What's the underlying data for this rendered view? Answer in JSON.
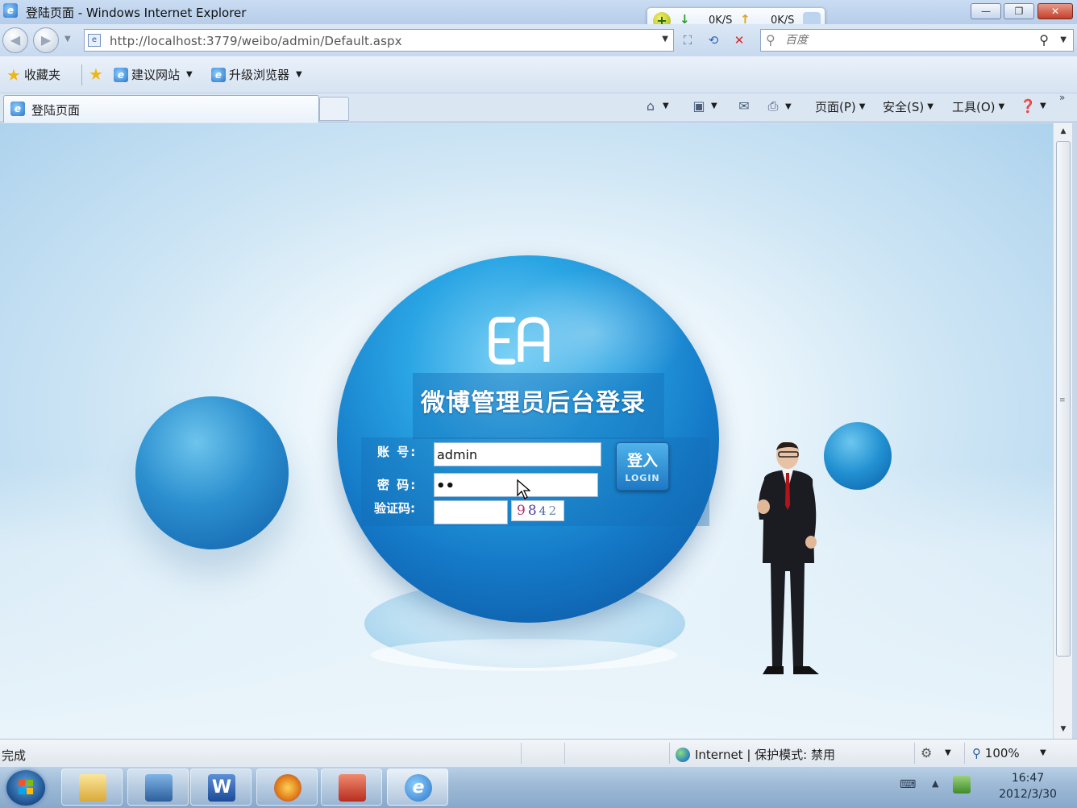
{
  "window": {
    "title": "登陆页面 - Windows Internet Explorer",
    "minimize": "—",
    "restore": "❐",
    "close": "✕"
  },
  "speed_widget": {
    "download": "0K/S",
    "upload": "0K/S"
  },
  "navigation": {
    "url": "http://localhost:3779/weibo/admin/Default.aspx",
    "search_placeholder": "百度"
  },
  "favorites_bar": {
    "favorites": "收藏夹",
    "suggested_sites": "建议网站",
    "upgrade_browser": "升级浏览器"
  },
  "tab": {
    "title": "登陆页面"
  },
  "command_bar": {
    "page": "页面(P)",
    "safety": "安全(S)",
    "tools": "工具(O)"
  },
  "login_page": {
    "title": "微博管理员后台登录",
    "account_label": "账 号:",
    "password_label": "密 码:",
    "captcha_label": "验证码:",
    "account_value": "admin",
    "password_masked": "••",
    "captcha_digits": [
      "9",
      "8",
      "4",
      "2"
    ],
    "login_button": "登入",
    "login_button_en": "LOGIN"
  },
  "status_bar": {
    "status": "完成",
    "zone": "Internet | 保护模式: 禁用",
    "zoom": "100%"
  },
  "taskbar": {
    "time": "16:47",
    "date": "2012/3/30",
    "apps": [
      "windows-explorer",
      "remote-desktop",
      "word",
      "visual-studio",
      "toolbox",
      "internet-explorer"
    ]
  },
  "colors": {
    "accent": "#1479c7",
    "chrome": "#c8d9ee",
    "close_red": "#c3402b"
  }
}
